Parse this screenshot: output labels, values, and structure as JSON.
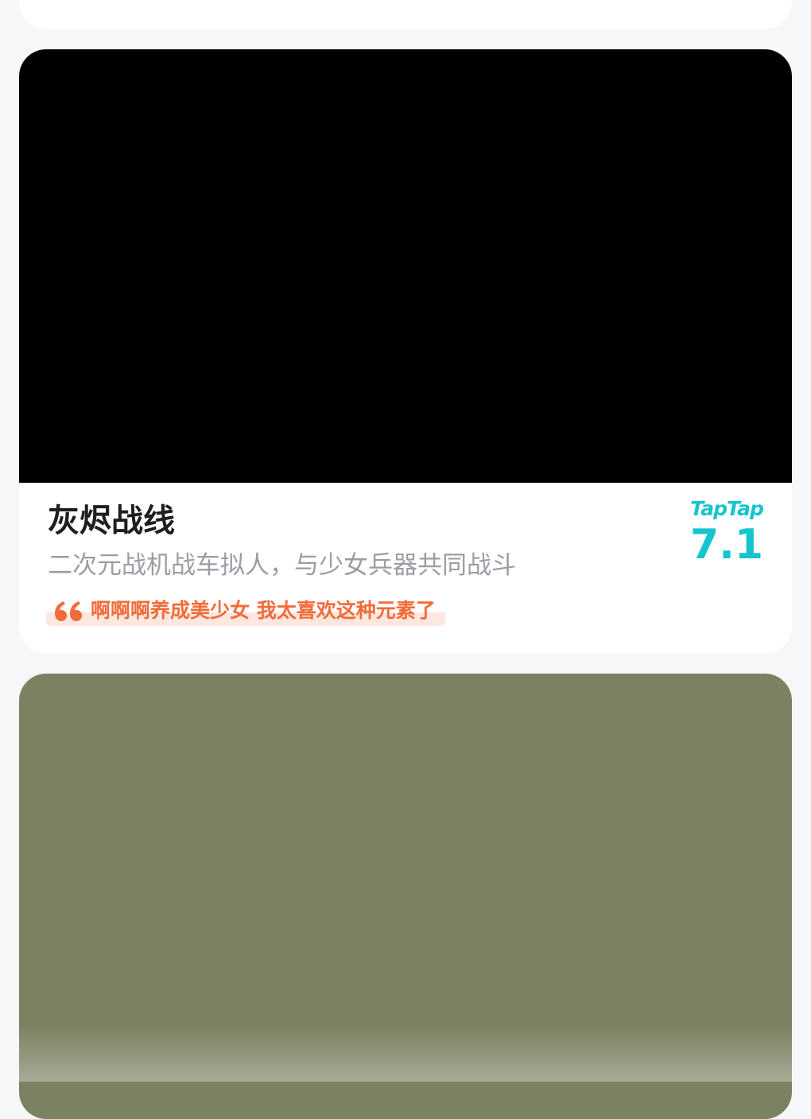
{
  "colors": {
    "page_background": "#f6f7f9",
    "card_background": "#ffffff",
    "media_primary": "#000000",
    "media_secondary": "#7b8262",
    "title": "#1f1f1f",
    "subtitle": "#9a9ea4",
    "review_accent": "#f26b3a",
    "review_highlight": "#fde7df",
    "rating_accent": "#15c5ce"
  },
  "game_card": {
    "title": "灰烬战线",
    "subtitle": "二次元战机战车拟人，与少女兵器共同战斗",
    "review": {
      "icon": "quote-icon",
      "text": "啊啊啊养成美少女 我太喜欢这种元素了"
    },
    "rating": {
      "brand": "TapTap",
      "score": "7.1"
    }
  }
}
